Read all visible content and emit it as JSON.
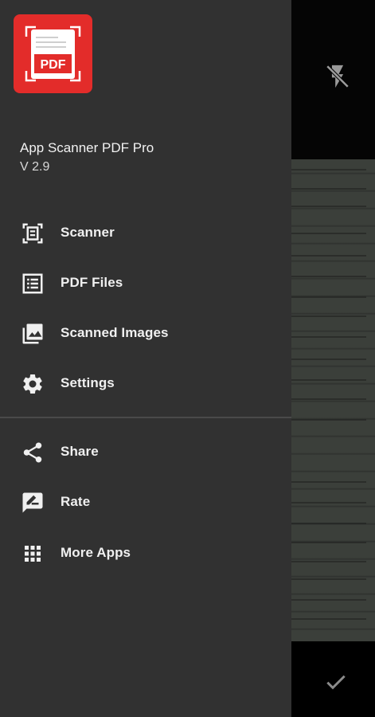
{
  "app": {
    "title": "App Scanner PDF Pro",
    "version": "V 2.9",
    "logo_text": "PDF"
  },
  "menu": {
    "primary": [
      {
        "label": "Scanner",
        "icon": "scanner-icon"
      },
      {
        "label": "PDF Files",
        "icon": "list-icon"
      },
      {
        "label": "Scanned Images",
        "icon": "photo-library-icon"
      },
      {
        "label": "Settings",
        "icon": "gear-icon"
      }
    ],
    "secondary": [
      {
        "label": "Share",
        "icon": "share-icon"
      },
      {
        "label": "Rate",
        "icon": "rate-icon"
      },
      {
        "label": "More Apps",
        "icon": "apps-grid-icon"
      }
    ]
  },
  "camera": {
    "flash_icon": "flash-off-icon",
    "confirm_icon": "check-icon"
  },
  "colors": {
    "drawer_bg": "#313131",
    "logo_red": "#e32c2a",
    "text": "#f0f0f0",
    "divider": "#4a4a4a"
  }
}
